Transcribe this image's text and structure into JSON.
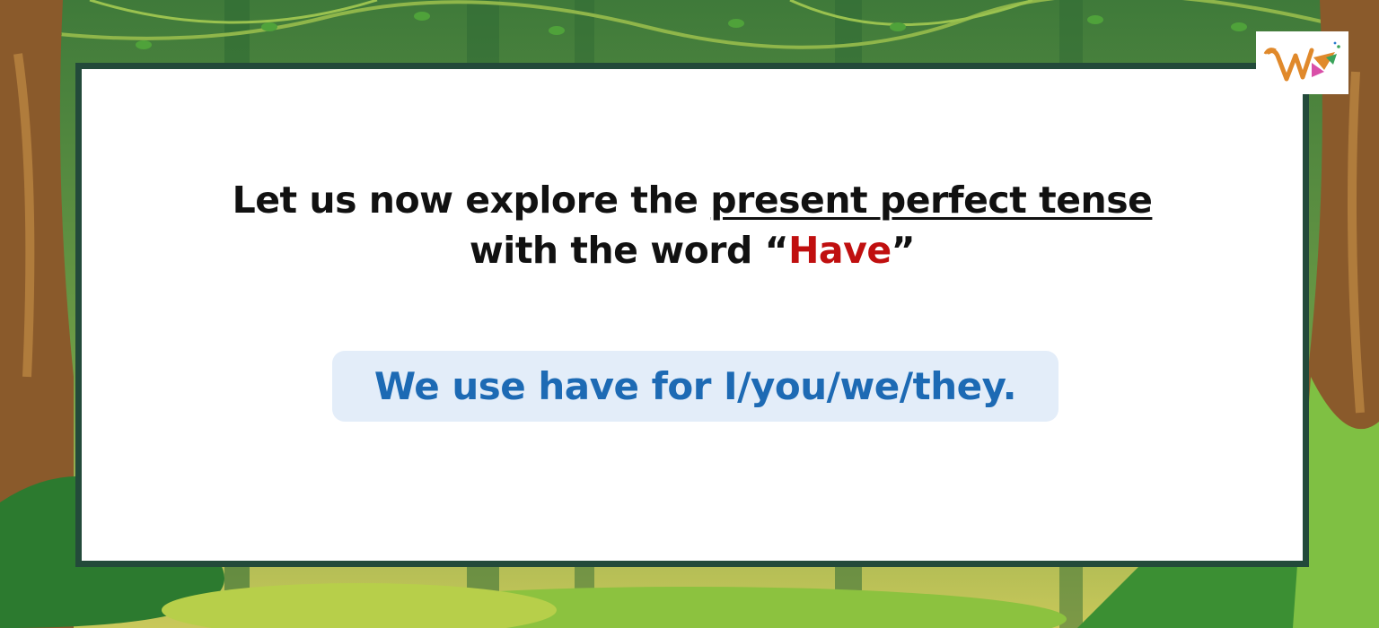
{
  "heading": {
    "line1_prefix": "Let us now explore the ",
    "line1_underlined": "present perfect tense",
    "line2_prefix": "with the word “",
    "line2_highlight": "Have",
    "line2_suffix": "”"
  },
  "note": {
    "text": "We use have for I/you/we/they."
  },
  "colors": {
    "highlight": "#c00f0f",
    "note_text": "#1d6ab4",
    "note_bg": "#e3edf9",
    "frame": "#234a3a"
  },
  "logo": {
    "icon": "w-brand-logo-icon"
  }
}
